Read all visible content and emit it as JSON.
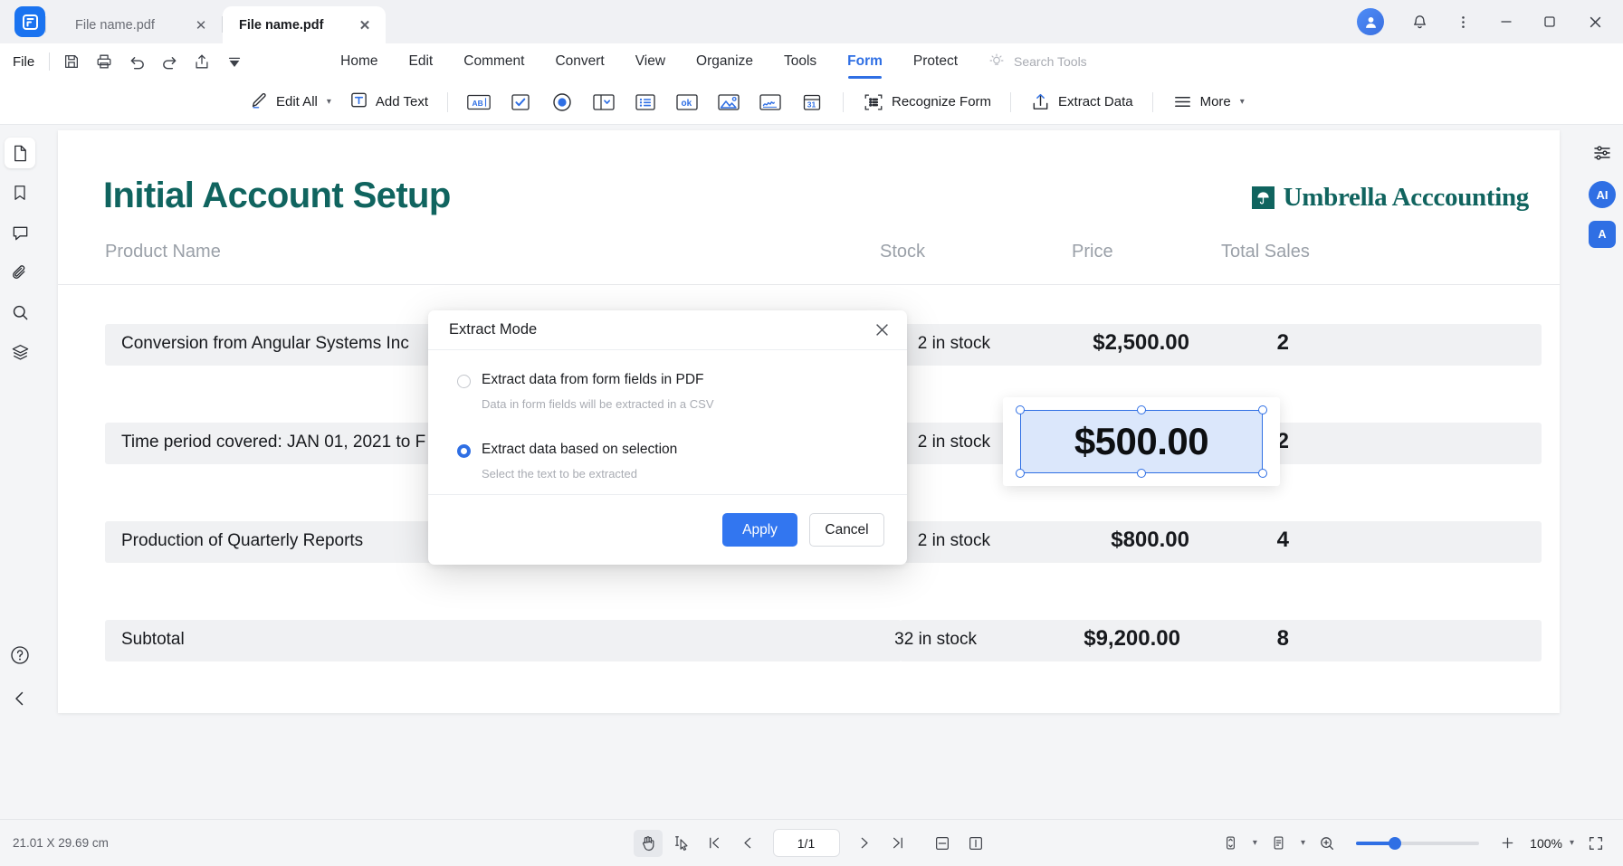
{
  "window": {
    "tabs": [
      {
        "label": "File name.pdf",
        "active": false,
        "close": "✕"
      },
      {
        "label": "File name.pdf",
        "active": true,
        "close": "✕"
      }
    ],
    "controls": {
      "minimize": "—",
      "maximize": "☐",
      "close": "✕",
      "notifications_icon": "bell-icon",
      "more_icon": "kebab-menu-icon",
      "avatar_icon": "user-avatar"
    }
  },
  "menubar": {
    "file_label": "File",
    "quick_access": [
      "save-icon",
      "print-icon",
      "undo-icon",
      "redo-icon",
      "share-icon",
      "dropdown-icon"
    ],
    "tabs": [
      {
        "label": "Home",
        "active": false
      },
      {
        "label": "Edit",
        "active": false
      },
      {
        "label": "Comment",
        "active": false
      },
      {
        "label": "Convert",
        "active": false
      },
      {
        "label": "View",
        "active": false
      },
      {
        "label": "Organize",
        "active": false
      },
      {
        "label": "Tools",
        "active": false
      },
      {
        "label": "Form",
        "active": true
      },
      {
        "label": "Protect",
        "active": false
      }
    ],
    "search_placeholder": "Search Tools",
    "search_icon": "lightbulb-icon",
    "cloud_icon": "cloud-upload-icon",
    "collapse_icon": "chevron-up-icon"
  },
  "ribbon": {
    "edit_all": "Edit All",
    "add_text": "Add Text",
    "field_tools": [
      {
        "name": "text-field-icon",
        "glyph": "AB"
      },
      {
        "name": "checkbox-field-icon",
        "glyph": "✓"
      },
      {
        "name": "radio-button-field-icon",
        "glyph": "●"
      },
      {
        "name": "combo-box-field-icon",
        "glyph": "⌄"
      },
      {
        "name": "list-box-field-icon",
        "glyph": "☰"
      },
      {
        "name": "push-button-field-icon",
        "glyph": "ok"
      },
      {
        "name": "image-field-icon",
        "glyph": "⛰"
      },
      {
        "name": "signature-field-icon",
        "glyph": "✎"
      },
      {
        "name": "date-field-icon",
        "glyph": "31"
      }
    ],
    "recognize_form": "Recognize Form",
    "extract_data": "Extract Data",
    "more": "More"
  },
  "left_sidebar": {
    "items": [
      {
        "name": "thumbnails-icon",
        "selected": true
      },
      {
        "name": "bookmark-icon",
        "selected": false
      },
      {
        "name": "comment-icon",
        "selected": false
      },
      {
        "name": "attachment-icon",
        "selected": false
      },
      {
        "name": "search-icon",
        "selected": false
      },
      {
        "name": "layers-icon",
        "selected": false
      }
    ],
    "help_icon": "help-icon",
    "collapse_icon": "chevron-left-icon"
  },
  "right_sidebar": {
    "properties_icon": "sliders-icon",
    "ai_badge": "AI",
    "translate_badge": "A",
    "expand_icon": "chevron-right-icon"
  },
  "document": {
    "title": "Initial Account Setup",
    "brand": "Umbrella Acccounting",
    "brand_mark_icon": "umbrella-icon",
    "columns": [
      "Product Name",
      "Stock",
      "Price",
      "Total Sales"
    ],
    "rows": [
      {
        "name": "Conversion from Angular Systems Inc",
        "stock": "2 in stock",
        "price": "$2,500.00",
        "total": "2",
        "highlight": true
      },
      {
        "name": "Time period covered: JAN 01, 2021 to F",
        "stock": "2 in stock",
        "price": "",
        "total": "2",
        "highlight": true
      },
      {
        "name": "Production of Quarterly Reports",
        "stock": "2 in stock",
        "price": "$800.00",
        "total": "4",
        "highlight": true
      },
      {
        "name": "Subtotal",
        "stock": "32 in stock",
        "price": "$9,200.00",
        "total": "8",
        "highlight": true
      }
    ],
    "selected_field": {
      "value": "$500.00"
    }
  },
  "modal": {
    "title": "Extract Mode",
    "close_icon": "close-icon",
    "options": [
      {
        "label": "Extract data from form fields in PDF",
        "sub": "Data in form fields will be extracted in a CSV",
        "checked": false
      },
      {
        "label": "Extract data based on selection",
        "sub": "Select the text to be extracted",
        "checked": true
      }
    ],
    "apply_label": "Apply",
    "cancel_label": "Cancel"
  },
  "statusbar": {
    "dimensions": "21.01 X 29.69 cm",
    "hand_tool_icon": "hand-tool-icon",
    "select_tool_icon": "select-tool-icon",
    "first_page_icon": "first-page-icon",
    "prev_page_icon": "prev-page-icon",
    "page_indicator": "1/1",
    "next_page_icon": "next-page-icon",
    "last_page_icon": "last-page-icon",
    "fit_page_icon": "fit-page-icon",
    "fit_width_icon": "fit-width-icon",
    "scroll_mode_icon": "scroll-mode-icon",
    "layout_mode_icon": "page-layout-icon",
    "zoom_out_icon": "zoom-out-icon",
    "zoom_in_icon": "zoom-in-icon",
    "zoom_level": "100%",
    "fullscreen_icon": "fullscreen-icon"
  },
  "colors": {
    "accent": "#2f6fe4",
    "primary_button": "#3276f0",
    "doc_brand": "#10645f",
    "chrome": "#f4f5f7"
  }
}
